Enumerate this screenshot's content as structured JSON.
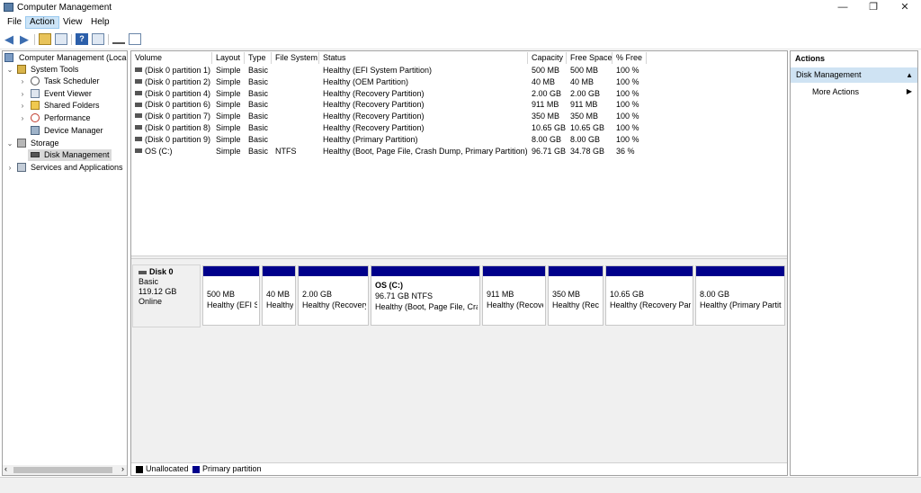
{
  "window": {
    "title": "Computer Management",
    "controls": {
      "minimize": "—",
      "maximize": "❐",
      "close": "✕"
    }
  },
  "menu": [
    "File",
    "Action",
    "View",
    "Help"
  ],
  "tree": {
    "root": "Computer Management (Local",
    "system_tools": "System Tools",
    "task_scheduler": "Task Scheduler",
    "event_viewer": "Event Viewer",
    "shared_folders": "Shared Folders",
    "performance": "Performance",
    "device_manager": "Device Manager",
    "storage": "Storage",
    "disk_management": "Disk Management",
    "services": "Services and Applications"
  },
  "volume_list": {
    "columns": [
      "Volume",
      "Layout",
      "Type",
      "File System",
      "Status",
      "Capacity",
      "Free Space",
      "% Free"
    ],
    "rows": [
      [
        "(Disk 0 partition 1)",
        "Simple",
        "Basic",
        "",
        "Healthy (EFI System Partition)",
        "500 MB",
        "500 MB",
        "100 %"
      ],
      [
        "(Disk 0 partition 2)",
        "Simple",
        "Basic",
        "",
        "Healthy (OEM Partition)",
        "40 MB",
        "40 MB",
        "100 %"
      ],
      [
        "(Disk 0 partition 4)",
        "Simple",
        "Basic",
        "",
        "Healthy (Recovery Partition)",
        "2.00 GB",
        "2.00 GB",
        "100 %"
      ],
      [
        "(Disk 0 partition 6)",
        "Simple",
        "Basic",
        "",
        "Healthy (Recovery Partition)",
        "911 MB",
        "911 MB",
        "100 %"
      ],
      [
        "(Disk 0 partition 7)",
        "Simple",
        "Basic",
        "",
        "Healthy (Recovery Partition)",
        "350 MB",
        "350 MB",
        "100 %"
      ],
      [
        "(Disk 0 partition 8)",
        "Simple",
        "Basic",
        "",
        "Healthy (Recovery Partition)",
        "10.65 GB",
        "10.65 GB",
        "100 %"
      ],
      [
        "(Disk 0 partition 9)",
        "Simple",
        "Basic",
        "",
        "Healthy (Primary Partition)",
        "8.00 GB",
        "8.00 GB",
        "100 %"
      ],
      [
        "OS (C:)",
        "Simple",
        "Basic",
        "NTFS",
        "Healthy (Boot, Page File, Crash Dump, Primary Partition)",
        "96.71 GB",
        "34.78 GB",
        "36 %"
      ]
    ]
  },
  "disk": {
    "name": "Disk 0",
    "type": "Basic",
    "size": "119.12 GB",
    "status": "Online",
    "partitions": [
      {
        "title": "",
        "size": "500 MB",
        "status": "Healthy (EFI S"
      },
      {
        "title": "",
        "size": "40 MB",
        "status": "Healthy"
      },
      {
        "title": "",
        "size": "2.00 GB",
        "status": "Healthy (Recovery"
      },
      {
        "title": "OS  (C:)",
        "size": "96.71 GB NTFS",
        "status": "Healthy (Boot, Page File, Cra"
      },
      {
        "title": "",
        "size": "911 MB",
        "status": "Healthy (Recove"
      },
      {
        "title": "",
        "size": "350 MB",
        "status": "Healthy (Rec"
      },
      {
        "title": "",
        "size": "10.65 GB",
        "status": "Healthy (Recovery Part"
      },
      {
        "title": "",
        "size": "8.00 GB",
        "status": "Healthy (Primary Partit"
      }
    ]
  },
  "legend": {
    "unallocated": "Unallocated",
    "primary": "Primary partition"
  },
  "colors": {
    "primary_partition": "#00008b",
    "unallocated": "#000000",
    "selection": "#cce8ff"
  },
  "actions": {
    "title": "Actions",
    "section": "Disk Management",
    "more": "More Actions"
  }
}
